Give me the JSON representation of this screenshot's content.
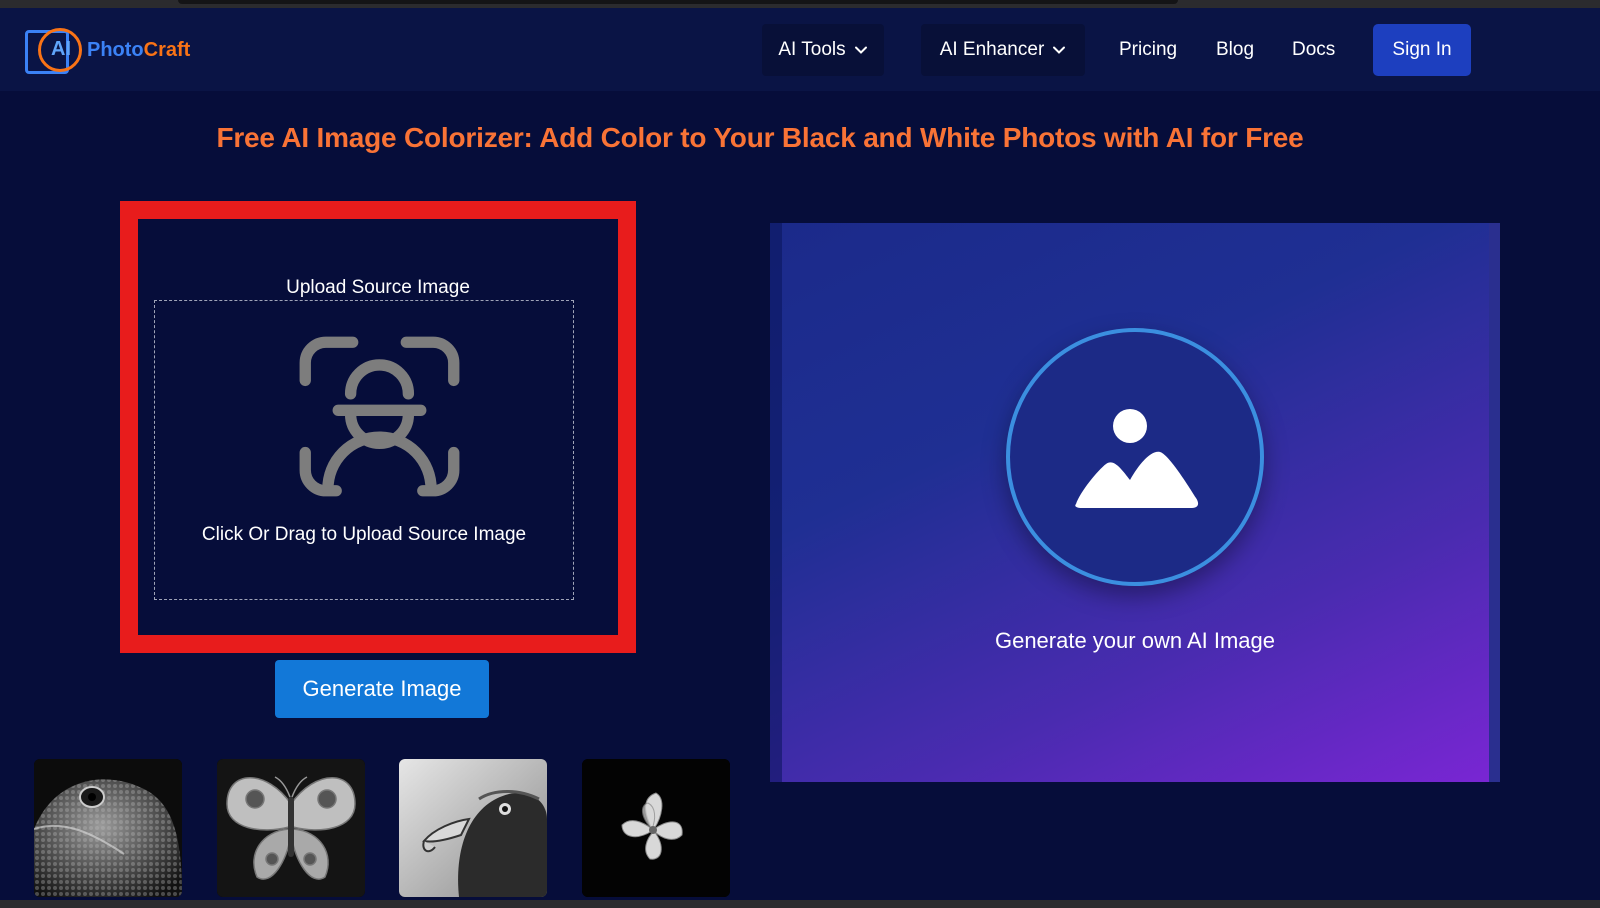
{
  "brand": {
    "badge_text": "AI",
    "name_part1": "Photo",
    "name_part2": "Craft",
    "color_blue": "#3b82f6",
    "color_orange": "#f97316"
  },
  "nav": {
    "ai_tools": "AI Tools",
    "ai_enhancer": "AI Enhancer",
    "pricing": "Pricing",
    "blog": "Blog",
    "docs": "Docs",
    "sign_in": "Sign In"
  },
  "page": {
    "title": "Free AI Image Colorizer: Add Color to Your Black and White Photos with AI for Free"
  },
  "upload": {
    "title": "Upload Source Image",
    "drop_text": "Click Or Drag to Upload Source Image",
    "highlight_color": "#e81c1c"
  },
  "actions": {
    "generate_label": "Generate Image"
  },
  "samples": [
    {
      "name": "lizard"
    },
    {
      "name": "butterfly"
    },
    {
      "name": "eagle"
    },
    {
      "name": "flower"
    }
  ],
  "preview": {
    "caption": "Generate your own AI Image"
  },
  "icons": {
    "upload": "face-scan-icon",
    "preview": "image-icon",
    "dropdown": "chevron-down-icon"
  }
}
